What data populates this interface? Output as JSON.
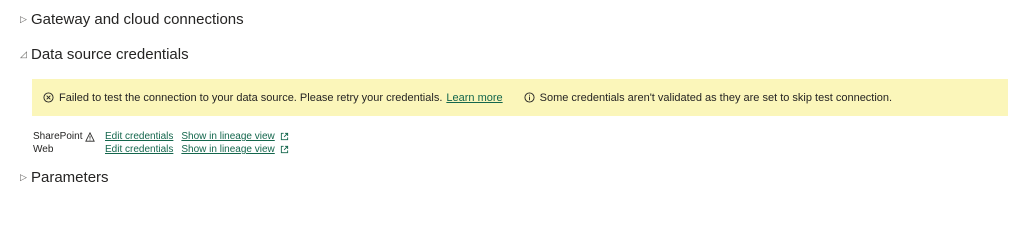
{
  "sections": {
    "gateway": {
      "label": "Gateway and cloud connections",
      "expanded": false
    },
    "datasource": {
      "label": "Data source credentials",
      "expanded": true
    },
    "parameters": {
      "label": "Parameters",
      "expanded": false
    }
  },
  "banner": {
    "background": "#fbf6ba",
    "error_icon": "circle-x-icon",
    "error_text": "Failed to test the connection to your data source. Please retry your credentials.",
    "learn_more": "Learn more",
    "info_icon": "info-icon",
    "info_text": "Some credentials aren't validated as they are set to skip test connection."
  },
  "credentials": [
    {
      "name": "SharePoint",
      "warning_icon": "warning-triangle-icon",
      "edit_label": "Edit credentials",
      "lineage_label": "Show in lineage view",
      "external_icon": "external-link-icon"
    },
    {
      "name": "Web",
      "edit_label": "Edit credentials",
      "lineage_label": "Show in lineage view",
      "external_icon": "external-link-icon"
    }
  ],
  "link_color": "#13664c"
}
